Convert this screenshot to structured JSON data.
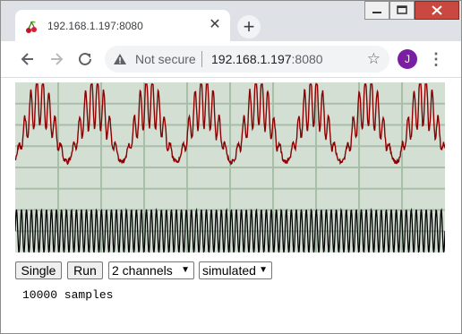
{
  "browser": {
    "tab_title": "192.168.1.197:8080",
    "tab_close_glyph": "✕",
    "new_tab_glyph": "+",
    "security_label": "Not secure",
    "url_host": "192.168.1.197",
    "url_port": ":8080",
    "profile_initial": "J",
    "profile_color": "#7b1fa2"
  },
  "page": {
    "buttons": {
      "single": "Single",
      "run": "Run"
    },
    "channels_select": {
      "selected": "2 channels"
    },
    "mode_select": {
      "selected": "simulated"
    },
    "status": "10000 samples"
  },
  "chart_data": {
    "type": "line",
    "title": "",
    "xlabel": "",
    "ylabel": "",
    "grid": true,
    "grid_divisions": {
      "x": 10,
      "y": 8
    },
    "background": "#d4dfd4",
    "grid_color": "#a9bea9",
    "series": [
      {
        "color": "#8b0000",
        "description": "modulated burst waveform, 8 envelope periods, upper 4 divisions",
        "envelope_periods": 8,
        "carrier_cycles_per_period": 9
      },
      {
        "color": "#000000",
        "description": "constant amplitude sine, lower 2 divisions",
        "cycles": 86
      }
    ]
  }
}
